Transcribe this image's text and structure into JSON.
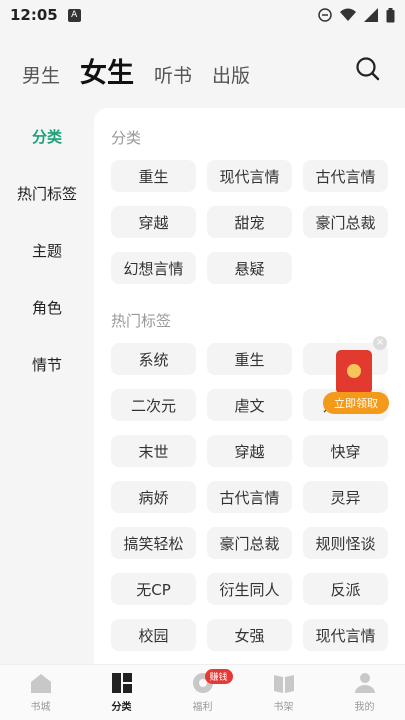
{
  "status_bar": {
    "time": "12:05"
  },
  "top_tabs": [
    {
      "label": "男生",
      "active": false
    },
    {
      "label": "女生",
      "active": true
    },
    {
      "label": "听书",
      "active": false
    },
    {
      "label": "出版",
      "active": false
    }
  ],
  "sidebar": {
    "items": [
      {
        "label": "分类",
        "active": true
      },
      {
        "label": "热门标签",
        "active": false
      },
      {
        "label": "主题",
        "active": false
      },
      {
        "label": "角色",
        "active": false
      },
      {
        "label": "情节",
        "active": false
      }
    ]
  },
  "sections": [
    {
      "title": "分类",
      "tags": [
        "重生",
        "现代言情",
        "古代言情",
        "穿越",
        "甜宠",
        "豪门总裁",
        "幻想言情",
        "悬疑"
      ]
    },
    {
      "title": "热门标签",
      "tags": [
        "系统",
        "重生",
        "双",
        "二次元",
        "虐文",
        "双女主",
        "末世",
        "穿越",
        "快穿",
        "病娇",
        "古代言情",
        "灵异",
        "搞笑轻松",
        "豪门总裁",
        "规则怪谈",
        "无CP",
        "衍生同人",
        "反派",
        "校园",
        "女强",
        "现代言情"
      ]
    }
  ],
  "floating_ad": {
    "label": "立即领取",
    "close": "×"
  },
  "bottom_nav": {
    "items": [
      {
        "label": "书城",
        "icon": "home-icon"
      },
      {
        "label": "分类",
        "icon": "category-icon",
        "active": true
      },
      {
        "label": "福利",
        "icon": "coin-icon",
        "badge": "赚钱"
      },
      {
        "label": "书架",
        "icon": "book-icon"
      },
      {
        "label": "我的",
        "icon": "profile-icon"
      }
    ]
  },
  "colors": {
    "accent": "#1aa37a",
    "badge": "#e53935",
    "ad_orange": "#f39a1a"
  }
}
